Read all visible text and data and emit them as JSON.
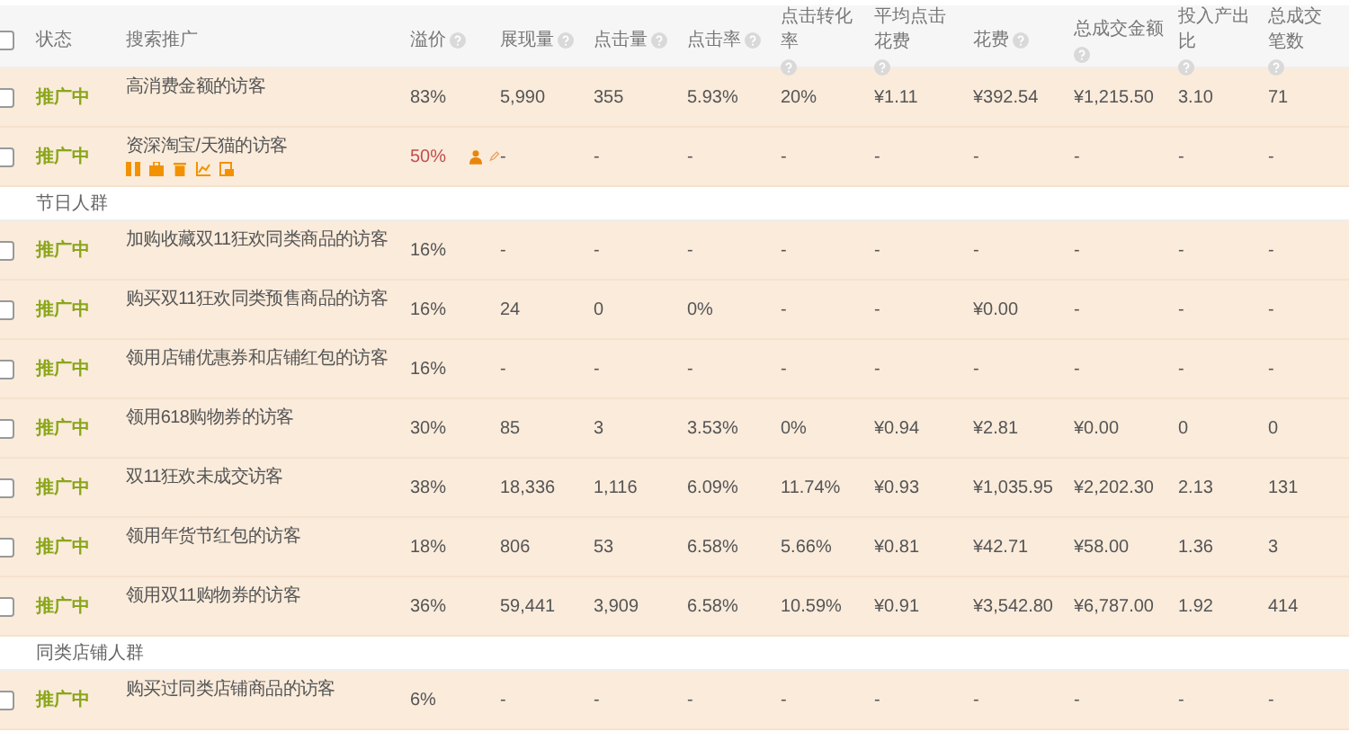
{
  "header": {
    "checked": false,
    "columns": [
      "状态",
      "搜索推广",
      "溢价",
      "展现量",
      "点击量",
      "点击率",
      "点击转化率",
      "平均点击花费",
      "花费",
      "总成交金额",
      "投入产出比",
      "总成交笔数"
    ]
  },
  "rows": [
    {
      "kind": "row",
      "checked": false,
      "status": "推广中",
      "name": "高消费金额的访客",
      "price": "83%",
      "cells": [
        "5,990",
        "355",
        "5.93%",
        "20%",
        "¥1.11",
        "¥392.54",
        "¥1,215.50",
        "3.10",
        "71"
      ]
    },
    {
      "kind": "row_edit",
      "checked": false,
      "status": "推广中",
      "name": "资深淘宝/天猫的访客",
      "price": "50%",
      "cells": [
        "-",
        "-",
        "-",
        "-",
        "-",
        "-",
        "-",
        "-",
        "-"
      ]
    },
    {
      "kind": "group",
      "name": "节日人群"
    },
    {
      "kind": "row",
      "checked": false,
      "status": "推广中",
      "name": "加购收藏双11狂欢同类商品的访客",
      "price": "16%",
      "cells": [
        "-",
        "-",
        "-",
        "-",
        "-",
        "-",
        "-",
        "-",
        "-"
      ]
    },
    {
      "kind": "row",
      "checked": false,
      "status": "推广中",
      "name": "购买双11狂欢同类预售商品的访客",
      "price": "16%",
      "cells": [
        "24",
        "0",
        "0%",
        "-",
        "-",
        "¥0.00",
        "-",
        "-",
        "-"
      ]
    },
    {
      "kind": "row",
      "checked": false,
      "status": "推广中",
      "name": "领用店铺优惠券和店铺红包的访客",
      "price": "16%",
      "cells": [
        "-",
        "-",
        "-",
        "-",
        "-",
        "-",
        "-",
        "-",
        "-"
      ]
    },
    {
      "kind": "row",
      "checked": false,
      "status": "推广中",
      "name": "领用618购物券的访客",
      "price": "30%",
      "cells": [
        "85",
        "3",
        "3.53%",
        "0%",
        "¥0.94",
        "¥2.81",
        "¥0.00",
        "0",
        "0"
      ]
    },
    {
      "kind": "row",
      "checked": false,
      "status": "推广中",
      "name": "双11狂欢未成交访客",
      "price": "38%",
      "cells": [
        "18,336",
        "1,116",
        "6.09%",
        "11.74%",
        "¥0.93",
        "¥1,035.95",
        "¥2,202.30",
        "2.13",
        "131"
      ]
    },
    {
      "kind": "row",
      "checked": false,
      "status": "推广中",
      "name": "领用年货节红包的访客",
      "price": "18%",
      "cells": [
        "806",
        "53",
        "6.58%",
        "5.66%",
        "¥0.81",
        "¥42.71",
        "¥58.00",
        "1.36",
        "3"
      ]
    },
    {
      "kind": "row",
      "checked": false,
      "status": "推广中",
      "name": "领用双11购物券的访客",
      "price": "36%",
      "cells": [
        "59,441",
        "3,909",
        "6.58%",
        "10.59%",
        "¥0.91",
        "¥3,542.80",
        "¥6,787.00",
        "1.92",
        "414"
      ]
    },
    {
      "kind": "group",
      "name": "同类店铺人群"
    },
    {
      "kind": "row",
      "checked": false,
      "status": "推广中",
      "name": "购买过同类店铺商品的访客",
      "price": "6%",
      "cells": [
        "-",
        "-",
        "-",
        "-",
        "-",
        "-",
        "-",
        "-",
        "-"
      ]
    }
  ]
}
